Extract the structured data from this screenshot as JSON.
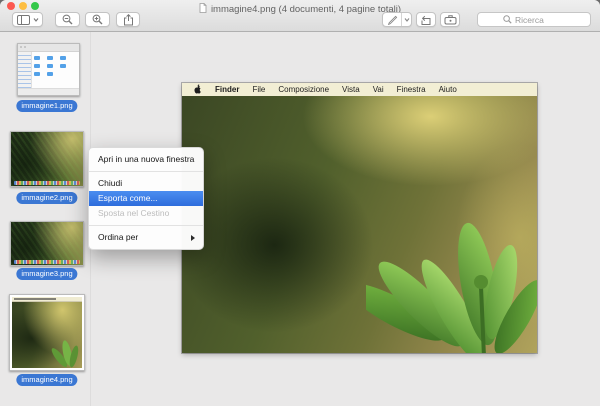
{
  "window": {
    "title": "immagine4.png (4 documenti, 4 pagine totali)"
  },
  "toolbar": {
    "search_placeholder": "Ricerca",
    "icons": [
      "sidebar-view",
      "zoom-out",
      "zoom-in",
      "share",
      "highlight-pen",
      "rotate",
      "markup-toolbox",
      "search"
    ]
  },
  "sidebar": {
    "items": [
      {
        "label": "immagine1.png",
        "selected": true
      },
      {
        "label": "immagine2.png",
        "selected": true
      },
      {
        "label": "immagine3.png",
        "selected": true
      },
      {
        "label": "immagine4.png",
        "selected": true
      }
    ]
  },
  "context_menu": {
    "items": {
      "open_new_window": "Apri in una nuova finestra",
      "close": "Chiudi",
      "export_as": "Esporta come...",
      "move_to_trash": "Sposta nel Cestino",
      "sort_by": "Ordina per"
    },
    "highlighted_item": "Esporta come...",
    "disabled_item": "Sposta nel Cestino"
  },
  "viewer_image": {
    "menu_bar_items": [
      "Finder",
      "File",
      "Composizione",
      "Vista",
      "Vai",
      "Finestra",
      "Aiuto"
    ]
  },
  "colors": {
    "menu_highlight": "#3a79dd",
    "label_blue": "#3b77d3",
    "traffic_red": "#fc5850",
    "traffic_yellow": "#fdbe41",
    "traffic_green": "#34c84a",
    "image_menubar": "#f2eed4"
  }
}
